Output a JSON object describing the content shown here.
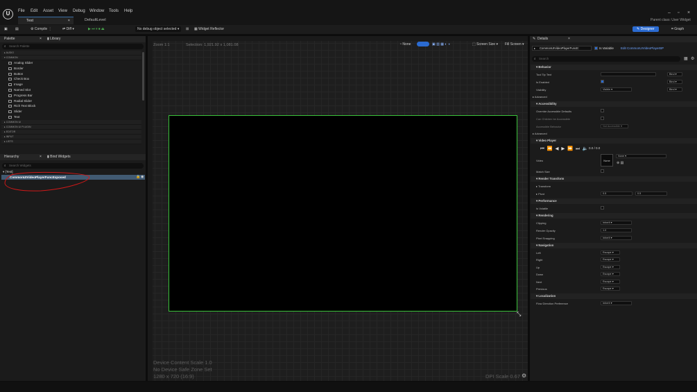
{
  "menu": [
    "File",
    "Edit",
    "Asset",
    "View",
    "Debug",
    "Window",
    "Tools",
    "Help"
  ],
  "tabs": [
    "Test",
    "DefaultLevel"
  ],
  "parent_class": "Parent class: User Widget",
  "toolbar": {
    "compile": "Compile",
    "diff": "Diff",
    "debug_select": "No debug object selected",
    "widget_reflector": "Widget Reflector",
    "designer": "Designer",
    "graph": "Graph"
  },
  "palette": {
    "tab_palette": "Palette",
    "tab_library": "Library",
    "search_placeholder": "Search Palette",
    "categories_top": [
      "AUDIO",
      "COMMON"
    ],
    "items": [
      "Analog Slider",
      "Border",
      "Button",
      "Check Box",
      "Image",
      "Named Slot",
      "Progress Bar",
      "Radial Slider",
      "Rich Text Block",
      "Slider",
      "Text"
    ],
    "categories_bottom": [
      "COMMON UI",
      "COMMON UI PLUGIN",
      "EDITOR",
      "INPUT",
      "LISTS"
    ]
  },
  "hierarchy": {
    "tab_hierarchy": "Hierarchy",
    "tab_bind": "Bind Widgets",
    "search_placeholder": "Search Widgets",
    "root": "[Test]",
    "child": "CommonUIVideoPlayerFuncExposed"
  },
  "canvas": {
    "zoom": "Zoom 1:1",
    "selection": "Selection: 1,921.92 x 1,081.08",
    "none": "None",
    "screen_size": "Screen Size",
    "fill_screen": "Fill Screen",
    "info_lines": [
      "Device Content Scale 1.0",
      "No Device Safe Zone Set",
      "1280 x 720 (16:9)"
    ],
    "dpi": "DPI Scale 0.67"
  },
  "details": {
    "tab": "Details",
    "name": "CommonUIVideoPlayerFuncE:",
    "is_variable": "Is Variable",
    "edit_link": "Edit CommonUIVideoPlayerBP",
    "search_placeholder": "Search",
    "behavior": "Behavior",
    "tool_tip_text": "Tool Tip Text",
    "bind": "Bind",
    "is_enabled": "Is Enabled",
    "visibility": "Visibility",
    "visibility_value": "Visible",
    "advanced": "Advanced",
    "accessibility": "Accessibility",
    "override_accessible": "Override Accessible Defaults",
    "can_children": "Can Children be Accessible",
    "accessible_behavior": "Accessible Behavior",
    "not_accessible": "Not Accessible",
    "advanced2": "Advanced",
    "video_player": "Video Player",
    "time": "0.0 / 0.0",
    "video": "Video",
    "none": "None",
    "match_size": "Match Size",
    "render_transform": "Render Transform",
    "transform": "Transform",
    "pivot": "Pivot",
    "pivot_x": "0.5",
    "pivot_y": "0.5",
    "performance": "Performance",
    "is_volatile": "Is Volatile",
    "rendering": "Rendering",
    "clipping": "Clipping",
    "clipping_value": "Inherit",
    "render_opacity": "Render Opacity",
    "opacity_value": "1.0",
    "pixel_snapping": "Pixel Snapping",
    "pixel_value": "Inherit",
    "navigation": "Navigation",
    "nav_rows": [
      {
        "label": "Left",
        "value": "Escape"
      },
      {
        "label": "Right",
        "value": "Escape"
      },
      {
        "label": "Up",
        "value": "Escape"
      },
      {
        "label": "Down",
        "value": "Escape"
      },
      {
        "label": "Next",
        "value": "Escape"
      },
      {
        "label": "Previous",
        "value": "Escape"
      }
    ],
    "localization": "Localization",
    "flow_direction": "Flow Direction Preference",
    "flow_value": "Inherit"
  },
  "colors": {
    "accent": "#2b6bd1",
    "selection_outline": "#3ac23a",
    "annotation": "#d01818"
  },
  "icons": [
    "unreal-logo-icon",
    "save-icon",
    "play-icon",
    "search-icon",
    "settings-icon"
  ]
}
